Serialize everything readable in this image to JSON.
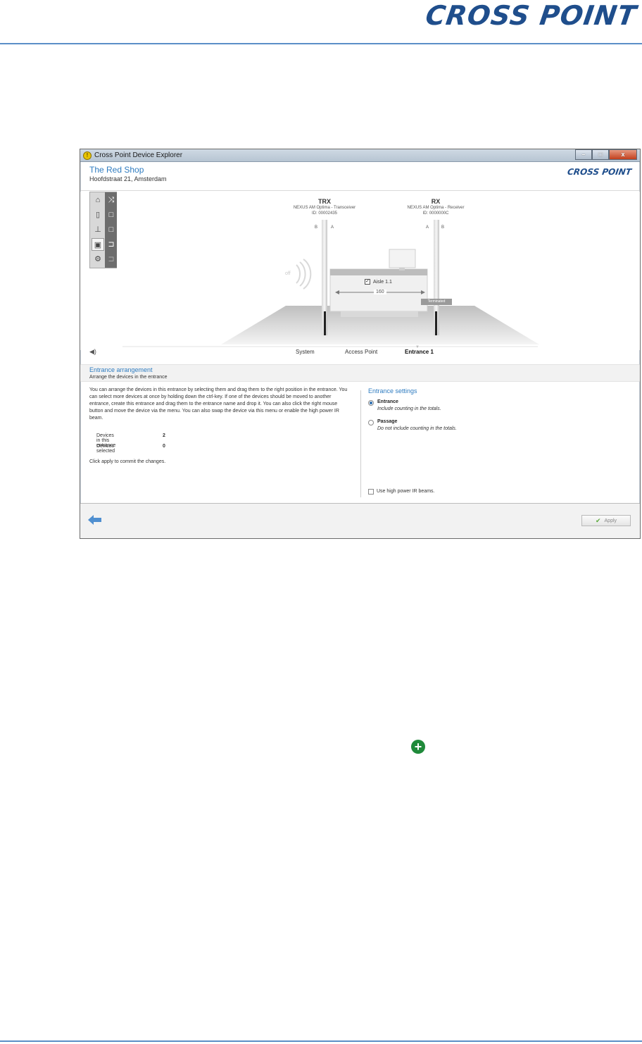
{
  "page": {
    "brand": "CROSS POINT"
  },
  "window": {
    "title": "Cross Point Device Explorer",
    "controls": {
      "minimize": "–",
      "maximize": "□",
      "close": "x"
    }
  },
  "header": {
    "shop_name": "The Red Shop",
    "address": "Hoofdstraat 21, Amsterdam",
    "logo": "CROSS POINT"
  },
  "toolbar": {
    "left_icons": [
      "home-icon",
      "device-icon",
      "pin-icon",
      "arrange-icon",
      "settings-icon"
    ],
    "right_icons": [
      "shuffle-icon",
      "square-icon",
      "square-icon",
      "export-icon",
      "import-icon"
    ]
  },
  "scene": {
    "trx": {
      "name": "TRX",
      "model": "NEXUS AM Optima - Transceiver",
      "id": "ID: 00002435"
    },
    "rx": {
      "name": "RX",
      "model": "NEXUS AM Optima - Receiver",
      "id": "ID: 0000000C"
    },
    "trx_ab": [
      "B",
      "A"
    ],
    "rx_ab": [
      "A",
      "B"
    ],
    "off_label": "off",
    "aisle_label": "Aisle 1.1",
    "aisle_checked": true,
    "distance": "160",
    "terminated": "Terminated"
  },
  "tabs": {
    "items": [
      "System",
      "Access Point",
      "Entrance 1"
    ],
    "active": "Entrance 1"
  },
  "section": {
    "title": "Entrance arrangement",
    "subtitle": "Arrange the devices in the entrance"
  },
  "description": "You can arrange the devices in this entrance by selecting them and drag them to the right position in the entrance. You can select more devices at once by holding down the ctrl-key. If one of the devices should be moved to another entrance, create this entrance and drag them to the entrance name and drop it. You can also click the right mouse button and move the device via the menu. You can also swap the device via this menu or enable the high power IR beam.",
  "stats": {
    "devices_in_entrance_label": "Devices in this entrance",
    "devices_in_entrance_value": "2",
    "devices_selected_label": "Devices selected",
    "devices_selected_value": "0"
  },
  "commit_text": "Click apply to commit the changes.",
  "settings": {
    "title": "Entrance settings",
    "options": [
      {
        "label": "Entrance",
        "desc": "Include counting in the totals.",
        "selected": true
      },
      {
        "label": "Passage",
        "desc": "Do not include counting in the totals.",
        "selected": false
      }
    ],
    "high_power_label": "Use high power IR beams.",
    "high_power_checked": false
  },
  "footer": {
    "apply_label": "Apply"
  },
  "colors": {
    "accent": "#2f7cc0",
    "brand": "#1f4e8c",
    "rule": "#5b8fc7",
    "plus": "#1f8a3a"
  }
}
